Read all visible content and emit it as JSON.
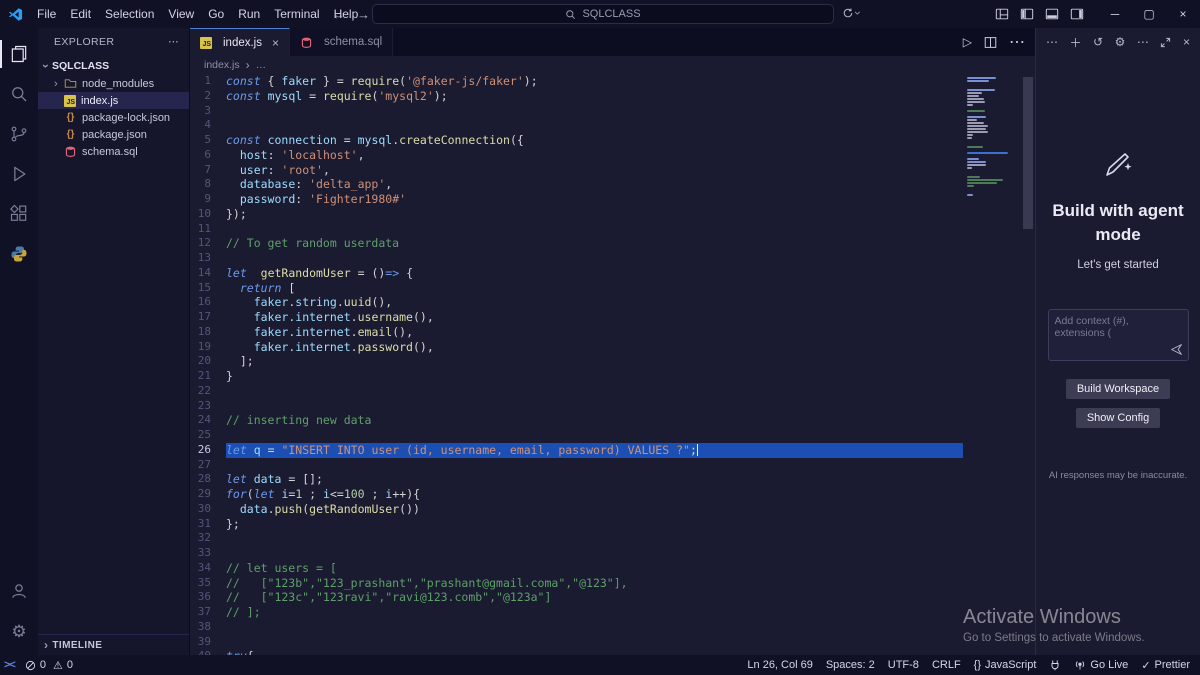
{
  "titlebar": {
    "menus": [
      "File",
      "Edit",
      "Selection",
      "View",
      "Go",
      "Run",
      "Terminal",
      "Help"
    ],
    "search": "SQLCLASS",
    "back": "←",
    "forward": "→",
    "minimize": "─",
    "restore": "▢",
    "close": "×"
  },
  "sidebar": {
    "header": "EXPLORER",
    "header_more": "⋯",
    "project": "SQLCLASS",
    "files": [
      {
        "name": "node_modules",
        "type": "folder",
        "selected": false
      },
      {
        "name": "index.js",
        "type": "js",
        "selected": true
      },
      {
        "name": "package-lock.json",
        "type": "json",
        "selected": false
      },
      {
        "name": "package.json",
        "type": "json",
        "selected": false
      },
      {
        "name": "schema.sql",
        "type": "sql",
        "selected": false
      }
    ],
    "timeline": "TIMELINE"
  },
  "tabs": [
    {
      "label": "index.js",
      "close": "×"
    },
    {
      "label": "schema.sql"
    }
  ],
  "tab_actions": {
    "run": "▷",
    "more": "⋯"
  },
  "breadcrumb": {
    "file": "index.js",
    "sep": "›",
    "more": "…"
  },
  "editor": {
    "selected_line": 26,
    "lines": [
      {
        "n": 1,
        "t": [
          [
            "k",
            "const"
          ],
          [
            "p",
            " { "
          ],
          [
            "v",
            "faker"
          ],
          [
            "p",
            " } "
          ],
          [
            "o",
            "= "
          ],
          [
            "f",
            "require"
          ],
          [
            "p",
            "("
          ],
          [
            "s",
            "'@faker-js/faker'"
          ],
          [
            "p",
            ");"
          ]
        ]
      },
      {
        "n": 2,
        "t": [
          [
            "k",
            "const"
          ],
          [
            "p",
            " "
          ],
          [
            "v",
            "mysql"
          ],
          [
            "o",
            " = "
          ],
          [
            "f",
            "require"
          ],
          [
            "p",
            "("
          ],
          [
            "s",
            "'mysql2'"
          ],
          [
            "p",
            ");"
          ]
        ]
      },
      {
        "n": 3,
        "t": []
      },
      {
        "n": 4,
        "t": []
      },
      {
        "n": 5,
        "t": [
          [
            "k",
            "const"
          ],
          [
            "p",
            " "
          ],
          [
            "v",
            "connection"
          ],
          [
            "o",
            " = "
          ],
          [
            "v",
            "mysql"
          ],
          [
            "p",
            "."
          ],
          [
            "f",
            "createConnection"
          ],
          [
            "p",
            "({"
          ]
        ]
      },
      {
        "n": 6,
        "t": [
          [
            "p",
            "  "
          ],
          [
            "v",
            "host"
          ],
          [
            "p",
            ": "
          ],
          [
            "s",
            "'localhost'"
          ],
          [
            "p",
            ","
          ]
        ]
      },
      {
        "n": 7,
        "t": [
          [
            "p",
            "  "
          ],
          [
            "v",
            "user"
          ],
          [
            "p",
            ": "
          ],
          [
            "s",
            "'root'"
          ],
          [
            "p",
            ","
          ]
        ]
      },
      {
        "n": 8,
        "t": [
          [
            "p",
            "  "
          ],
          [
            "v",
            "database"
          ],
          [
            "p",
            ": "
          ],
          [
            "s",
            "'delta_app'"
          ],
          [
            "p",
            ","
          ]
        ]
      },
      {
        "n": 9,
        "t": [
          [
            "p",
            "  "
          ],
          [
            "v",
            "password"
          ],
          [
            "p",
            ": "
          ],
          [
            "s",
            "'Fighter1980#'"
          ]
        ]
      },
      {
        "n": 10,
        "t": [
          [
            "p",
            "});"
          ]
        ]
      },
      {
        "n": 11,
        "t": []
      },
      {
        "n": 12,
        "t": [
          [
            "c",
            "// To get random userdata"
          ]
        ]
      },
      {
        "n": 13,
        "t": []
      },
      {
        "n": 14,
        "t": [
          [
            "k",
            "let"
          ],
          [
            "p",
            "  "
          ],
          [
            "f",
            "getRandomUser"
          ],
          [
            "o",
            " = "
          ],
          [
            "p",
            "()"
          ],
          [
            "k",
            "=>"
          ],
          [
            "p",
            " {"
          ]
        ]
      },
      {
        "n": 15,
        "t": [
          [
            "p",
            "  "
          ],
          [
            "k",
            "return"
          ],
          [
            "p",
            " ["
          ]
        ]
      },
      {
        "n": 16,
        "t": [
          [
            "p",
            "    "
          ],
          [
            "v",
            "faker"
          ],
          [
            "p",
            "."
          ],
          [
            "v",
            "string"
          ],
          [
            "p",
            "."
          ],
          [
            "f",
            "uuid"
          ],
          [
            "p",
            "(),"
          ]
        ]
      },
      {
        "n": 17,
        "t": [
          [
            "p",
            "    "
          ],
          [
            "v",
            "faker"
          ],
          [
            "p",
            "."
          ],
          [
            "v",
            "internet"
          ],
          [
            "p",
            "."
          ],
          [
            "f",
            "username"
          ],
          [
            "p",
            "(),"
          ]
        ]
      },
      {
        "n": 18,
        "t": [
          [
            "p",
            "    "
          ],
          [
            "v",
            "faker"
          ],
          [
            "p",
            "."
          ],
          [
            "v",
            "internet"
          ],
          [
            "p",
            "."
          ],
          [
            "f",
            "email"
          ],
          [
            "p",
            "(),"
          ]
        ]
      },
      {
        "n": 19,
        "t": [
          [
            "p",
            "    "
          ],
          [
            "v",
            "faker"
          ],
          [
            "p",
            "."
          ],
          [
            "v",
            "internet"
          ],
          [
            "p",
            "."
          ],
          [
            "f",
            "password"
          ],
          [
            "p",
            "(),"
          ]
        ]
      },
      {
        "n": 20,
        "t": [
          [
            "p",
            "  ];"
          ]
        ]
      },
      {
        "n": 21,
        "t": [
          [
            "p",
            "}"
          ]
        ]
      },
      {
        "n": 22,
        "t": []
      },
      {
        "n": 23,
        "t": []
      },
      {
        "n": 24,
        "t": [
          [
            "c",
            "// inserting new data"
          ]
        ]
      },
      {
        "n": 25,
        "t": []
      },
      {
        "n": 26,
        "t": [
          [
            "k",
            "let"
          ],
          [
            "p",
            " "
          ],
          [
            "v",
            "q"
          ],
          [
            "o",
            " = "
          ],
          [
            "s",
            "\"INSERT INTO user (id, username, email, password) VALUES ?\""
          ],
          [
            "p",
            ";"
          ]
        ]
      },
      {
        "n": 27,
        "t": []
      },
      {
        "n": 28,
        "t": [
          [
            "k",
            "let"
          ],
          [
            "p",
            " "
          ],
          [
            "v",
            "data"
          ],
          [
            "o",
            " = "
          ],
          [
            "p",
            "[];"
          ]
        ]
      },
      {
        "n": 29,
        "t": [
          [
            "k",
            "for"
          ],
          [
            "p",
            "("
          ],
          [
            "k",
            "let"
          ],
          [
            "p",
            " "
          ],
          [
            "v",
            "i"
          ],
          [
            "o",
            "="
          ],
          [
            "n",
            "1"
          ],
          [
            "p",
            " ; "
          ],
          [
            "v",
            "i"
          ],
          [
            "o",
            "<="
          ],
          [
            "n",
            "100"
          ],
          [
            "p",
            " ; "
          ],
          [
            "v",
            "i"
          ],
          [
            "o",
            "++"
          ],
          [
            "p",
            "){"
          ]
        ]
      },
      {
        "n": 30,
        "t": [
          [
            "p",
            "  "
          ],
          [
            "v",
            "data"
          ],
          [
            "p",
            "."
          ],
          [
            "f",
            "push"
          ],
          [
            "p",
            "("
          ],
          [
            "f",
            "getRandomUser"
          ],
          [
            "p",
            "())"
          ]
        ]
      },
      {
        "n": 31,
        "t": [
          [
            "p",
            "};"
          ]
        ]
      },
      {
        "n": 32,
        "t": []
      },
      {
        "n": 33,
        "t": []
      },
      {
        "n": 34,
        "t": [
          [
            "c",
            "// let users = ["
          ]
        ]
      },
      {
        "n": 35,
        "t": [
          [
            "c",
            "//   [\"123b\",\"123_prashant\",\"prashant@gmail.coma\",\"@123\"],"
          ]
        ]
      },
      {
        "n": 36,
        "t": [
          [
            "c",
            "//   [\"123c\",\"123ravi\",\"ravi@123.comb\",\"@123a\"]"
          ]
        ]
      },
      {
        "n": 37,
        "t": [
          [
            "c",
            "// ];"
          ]
        ]
      },
      {
        "n": 38,
        "t": []
      },
      {
        "n": 39,
        "t": []
      },
      {
        "n": 40,
        "t": [
          [
            "k",
            "try"
          ],
          [
            "p",
            "{"
          ]
        ]
      }
    ]
  },
  "chat": {
    "title": "Build with agent mode",
    "subtitle": "Let's get started",
    "placeholder": "Add context (#), extensions (",
    "button_primary": "Build Workspace",
    "button_secondary": "Show Config",
    "disclaimer": "AI responses may be inaccurate."
  },
  "watermark": {
    "line1": "Activate Windows",
    "line2": "Go to Settings to activate Windows."
  },
  "statusbar": {
    "errors": "0",
    "warnings": "0",
    "ln_col": "Ln 26, Col 69",
    "spaces": "Spaces: 2",
    "encoding": "UTF-8",
    "eol": "CRLF",
    "lang_braces": "{}",
    "language": "JavaScript",
    "golive": "Go Live",
    "prettier_check": "✓",
    "prettier": "Prettier"
  }
}
